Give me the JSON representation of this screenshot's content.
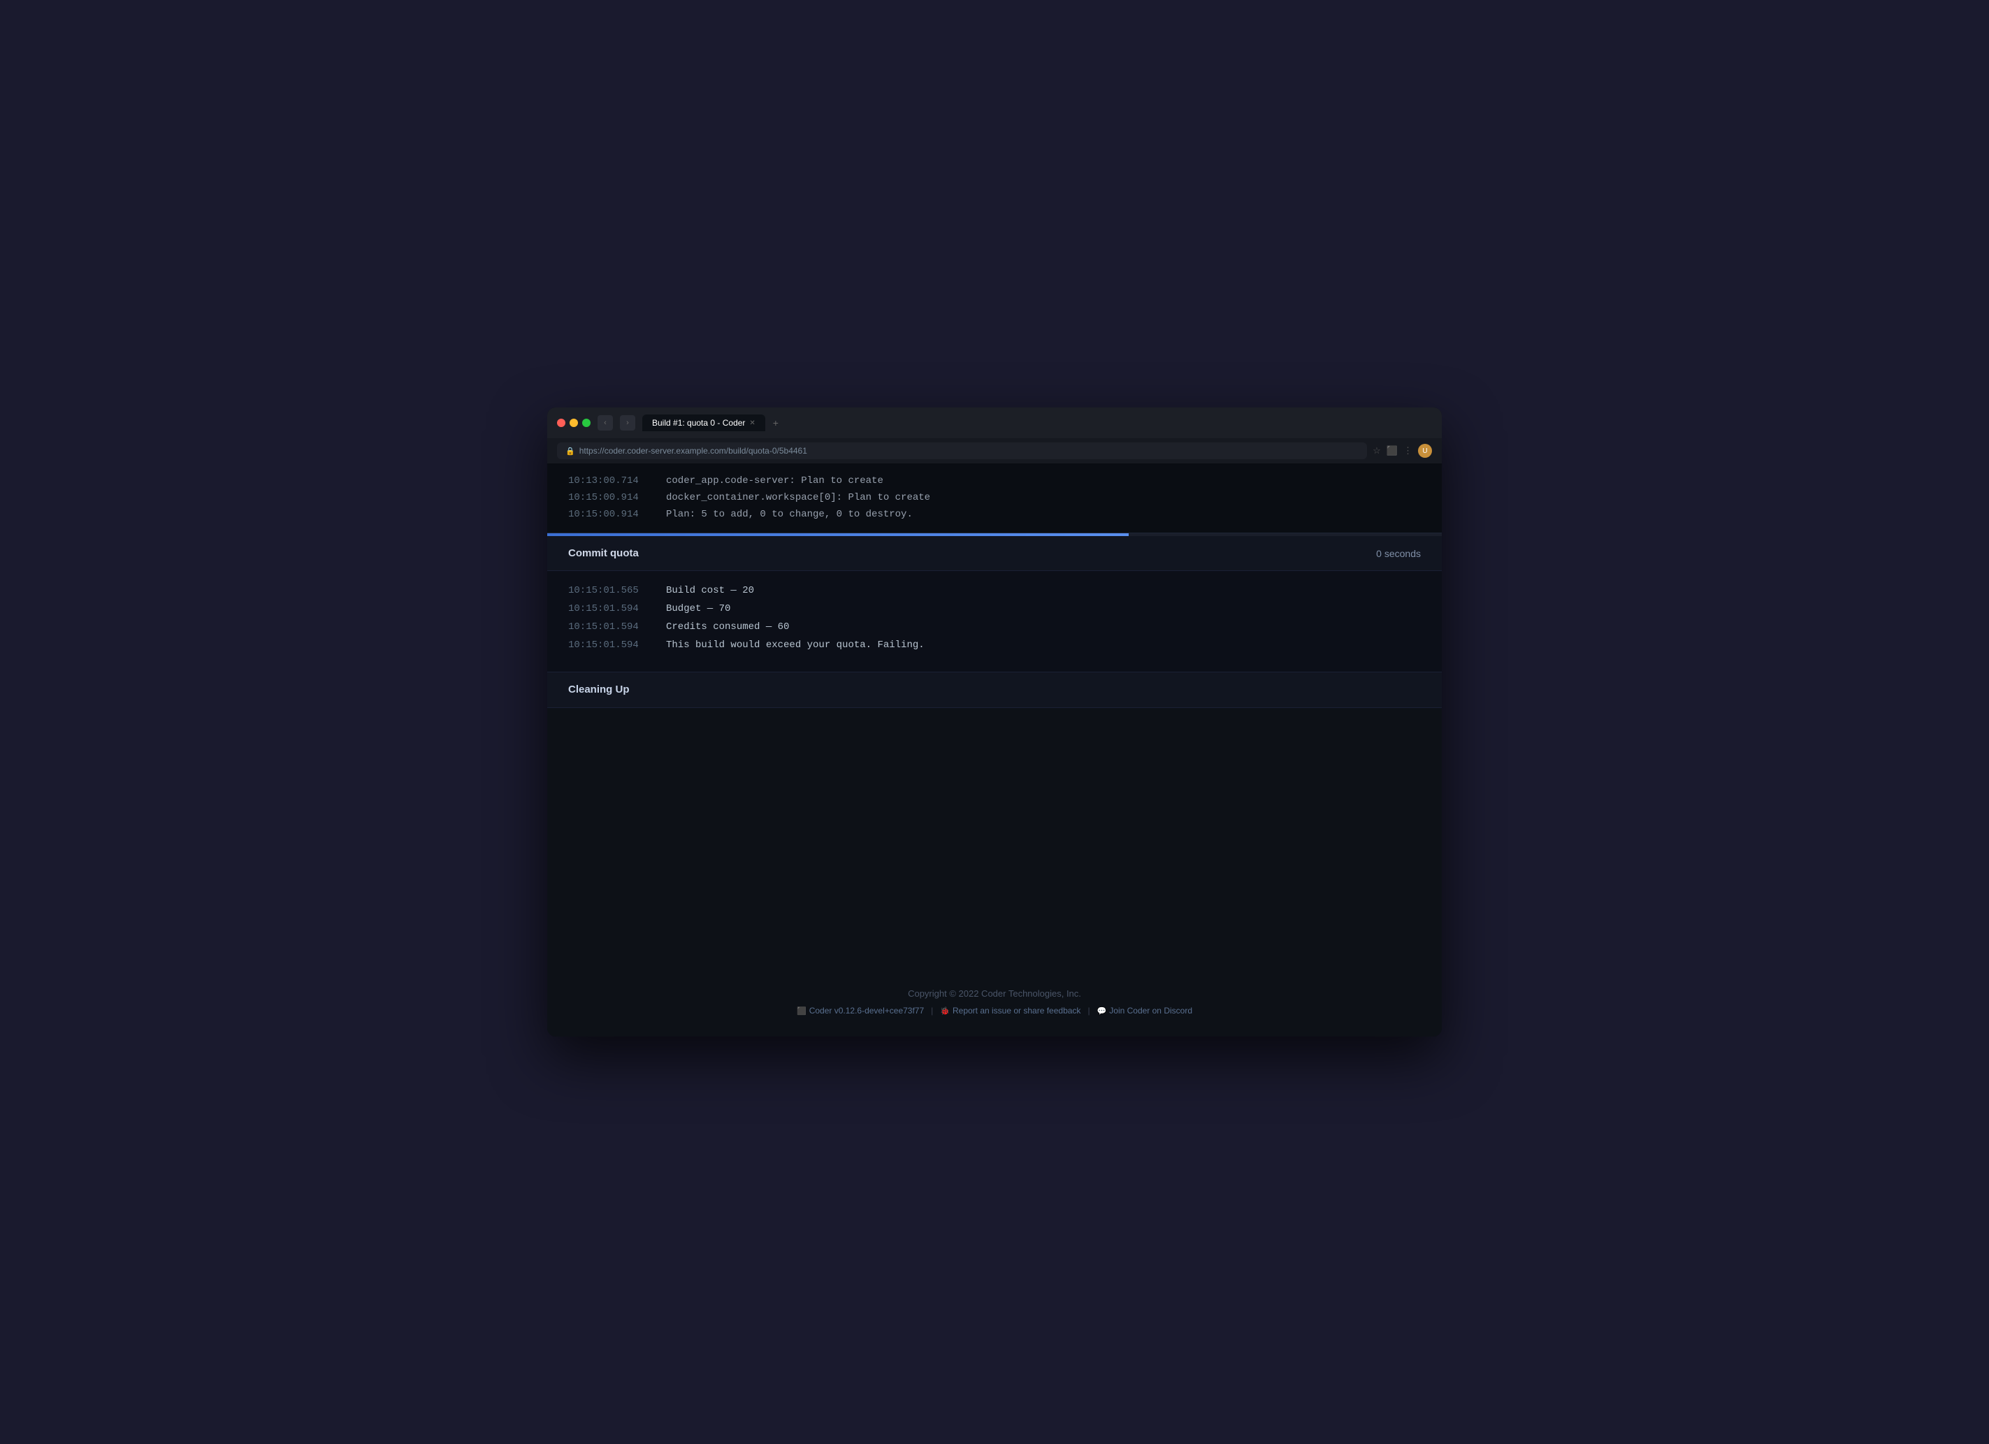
{
  "browser": {
    "tab_title": "Build #1: quota 0 - Coder",
    "tab_new_label": "+",
    "url": "https://coder.coder-server.example.com/build/quota-0/5b4461",
    "traffic_lights": [
      "red",
      "yellow",
      "green"
    ]
  },
  "terminal": {
    "lines": [
      {
        "time": "10:13:00.714",
        "msg": "coder_app.code-server: Plan to create"
      },
      {
        "time": "10:15:00.914",
        "msg": "docker_container.workspace[0]: Plan to create"
      },
      {
        "time": "10:15:00.914",
        "msg": "Plan: 5 to add, 0 to change, 0 to destroy."
      }
    ]
  },
  "sections": [
    {
      "id": "commit-quota",
      "title": "Commit quota",
      "time": "0 seconds",
      "logs": [
        {
          "time": "10:15:01.565",
          "msg": "Build cost      —   20"
        },
        {
          "time": "10:15:01.594",
          "msg": "Budget          —   70"
        },
        {
          "time": "10:15:01.594",
          "msg": "Credits consumed —   60"
        },
        {
          "time": "10:15:01.594",
          "msg": "This build would exceed your quota. Failing."
        }
      ]
    }
  ],
  "cleaning_section": {
    "title": "Cleaning Up"
  },
  "footer": {
    "copyright": "Copyright © 2022 Coder Technologies, Inc.",
    "link1_icon": "coder-icon",
    "link1_text": "Coder v0.12.6-devel+cee73f77",
    "separator1": "|",
    "link2_icon": "bug-icon",
    "link2_text": "Report an issue or share feedback",
    "separator2": "|",
    "link3_icon": "discord-icon",
    "link3_text": "Join Coder on Discord"
  }
}
